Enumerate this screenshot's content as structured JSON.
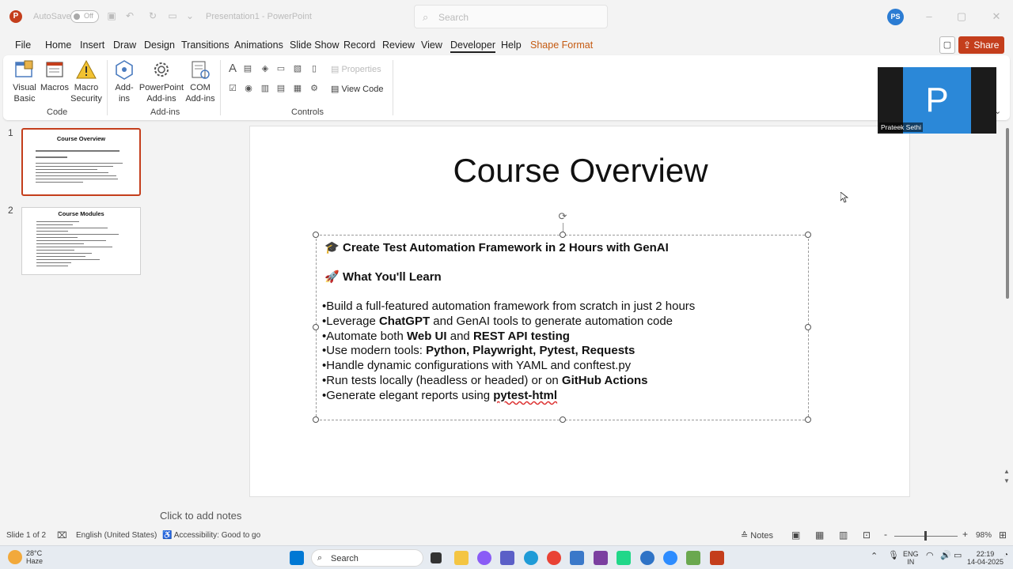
{
  "titlebar": {
    "autosave_label": "AutoSave",
    "autosave_state": "Off",
    "doc_title": "Presentation1 - PowerPoint",
    "search_placeholder": "Search",
    "user_initials": "PS"
  },
  "menu": {
    "tabs": [
      "File",
      "Home",
      "Insert",
      "Draw",
      "Design",
      "Transitions",
      "Animations",
      "Slide Show",
      "Record",
      "Review",
      "View",
      "Developer",
      "Help",
      "Shape Format"
    ],
    "active_tab": "Developer",
    "share_label": "Share"
  },
  "ribbon": {
    "code": {
      "visual_basic": "Visual Basic",
      "macros": "Macros",
      "macro_security": "Macro Security",
      "label": "Code"
    },
    "addins": {
      "addins": "Add-ins",
      "powerpoint_addins": "PowerPoint Add-ins",
      "com_addins": "COM Add-ins",
      "label": "Add-ins"
    },
    "controls": {
      "properties": "Properties",
      "view_code": "View Code",
      "label": "Controls"
    }
  },
  "thumbnails": [
    {
      "number": "1",
      "title": "Course Overview"
    },
    {
      "number": "2",
      "title": "Course Modules"
    }
  ],
  "slide": {
    "title": "Course Overview",
    "heading1_icon": "graduation-cap-icon",
    "heading1": "Create Test Automation Framework in 2 Hours with GenAI",
    "heading2_icon": "rocket-icon",
    "heading2": "What You'll Learn",
    "bullets": {
      "b1": "•Build a full-featured automation framework from scratch in just 2 hours",
      "b2_pre": "•Leverage ",
      "b2_bold": "ChatGPT",
      "b2_post": " and GenAI tools to generate automation code",
      "b3_pre": "•Automate both ",
      "b3_bold1": "Web UI",
      "b3_mid": " and ",
      "b3_bold2": "REST API testing",
      "b4_pre": "•Use modern tools: ",
      "b4_bold": "Python, Playwright, Pytest, Requests",
      "b5": "•Handle dynamic configurations with YAML and conftest.py",
      "b6_pre": "•Run tests locally (headless or headed) or on ",
      "b6_bold": "GitHub Actions",
      "b7_pre": "•Generate elegant reports using ",
      "b7_bold": "pytest-html"
    }
  },
  "video_tile": {
    "letter": "P",
    "name": "Prateek Sethi"
  },
  "notes": {
    "placeholder": "Click to add notes"
  },
  "statusbar": {
    "slide_info": "Slide 1 of 2",
    "language": "English (United States)",
    "accessibility": "Accessibility: Good to go",
    "notes_label": "Notes",
    "zoom_minus": "-",
    "zoom_plus": "+",
    "zoom": "98%"
  },
  "taskbar": {
    "temperature": "28°C",
    "weather": "Haze",
    "search_label": "Search",
    "lang_line1": "ENG",
    "lang_line2": "IN",
    "time": "22:19",
    "date": "14-04-2025"
  },
  "colors": {
    "accent": "#c43e1c",
    "avatar": "#2b7cd3",
    "video_tile": "#2b88d8",
    "shape_format": "#c55a11"
  }
}
